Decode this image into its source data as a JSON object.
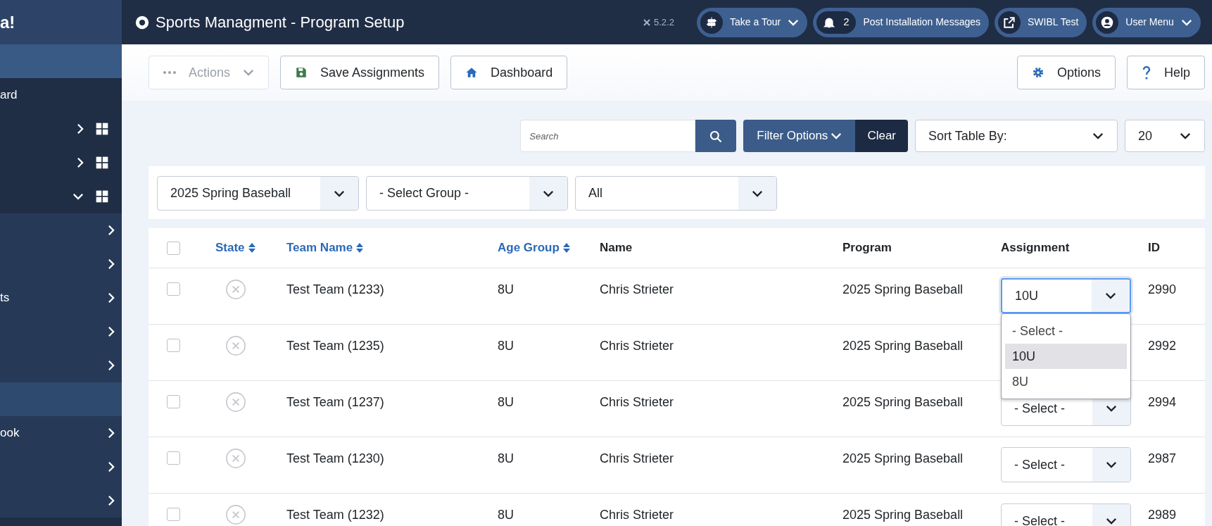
{
  "sidebar": {
    "logo_text": "a!",
    "items": [
      {
        "kind": "link",
        "selected": true
      },
      {
        "kind": "link",
        "label": "ard",
        "selected": false
      },
      {
        "kind": "menu",
        "expanded": false
      },
      {
        "kind": "menu",
        "expanded": false
      },
      {
        "kind": "menu",
        "expanded": true,
        "children": [
          {
            "kind": "submenu",
            "selected": false
          },
          {
            "kind": "submenu",
            "selected": false
          },
          {
            "kind": "submenu",
            "label": "ts",
            "selected": false
          },
          {
            "kind": "submenu",
            "selected": false
          },
          {
            "kind": "submenu",
            "selected": false
          },
          {
            "kind": "link",
            "selected": true
          },
          {
            "kind": "submenu",
            "label": "ook",
            "selected": false
          },
          {
            "kind": "submenu",
            "selected": false
          },
          {
            "kind": "submenu",
            "selected": false
          }
        ]
      }
    ]
  },
  "header": {
    "title": "Sports Managment - Program Setup",
    "version": "5.2.2",
    "buttons": [
      {
        "kind": "tour",
        "label": "Take a Tour"
      },
      {
        "kind": "messages",
        "count": "2",
        "label": "Post Installation Messages"
      },
      {
        "kind": "site",
        "label": "SWIBL Test"
      },
      {
        "kind": "user",
        "label": "User Menu"
      }
    ]
  },
  "toolbar": {
    "left": [
      {
        "kind": "actions",
        "label": "Actions",
        "disabled": true
      },
      {
        "kind": "save",
        "label": "Save Assignments",
        "disabled": false
      },
      {
        "kind": "home",
        "label": "Dashboard",
        "disabled": false
      }
    ],
    "right": [
      {
        "kind": "options",
        "label": "Options"
      },
      {
        "kind": "help",
        "label": "Help"
      }
    ]
  },
  "search": {
    "placeholder": "Search",
    "filter_button": "Filter Options",
    "clear_button": "Clear",
    "sort": "Sort Table By:",
    "limit": "20"
  },
  "filters": [
    "2025 Spring Baseball",
    "- Select Group -",
    "All"
  ],
  "table": {
    "select_all_checked": false,
    "columns": [
      {
        "label": "State",
        "sortable": true
      },
      {
        "label": "Team Name",
        "sortable": true
      },
      {
        "label": "Age Group",
        "sortable": true
      },
      {
        "label": "Name",
        "sortable": false
      },
      {
        "label": "Program",
        "sortable": false
      },
      {
        "label": "Assignment",
        "sortable": false
      },
      {
        "label": "ID",
        "sortable": false
      }
    ],
    "assignment_options": [
      {
        "label": "- Select -",
        "selected": false
      },
      {
        "label": "10U",
        "selected": true
      },
      {
        "label": "8U",
        "selected": false
      }
    ],
    "rows": [
      {
        "checked": false,
        "published": false,
        "team": "Test Team (1233)",
        "age": "8U",
        "name": "Chris Strieter",
        "program": "2025 Spring Baseball",
        "assignment": "10U",
        "dropdown_open": true,
        "id": "2990"
      },
      {
        "checked": false,
        "published": false,
        "team": "Test Team (1235)",
        "age": "8U",
        "name": "Chris Strieter",
        "program": "2025 Spring Baseball",
        "id": "2992"
      },
      {
        "checked": false,
        "published": false,
        "team": "Test Team (1237)",
        "age": "8U",
        "name": "Chris Strieter",
        "program": "2025 Spring Baseball",
        "assignment": "- Select -",
        "dropdown_open": false,
        "id": "2994"
      },
      {
        "checked": false,
        "published": false,
        "team": "Test Team (1230)",
        "age": "8U",
        "name": "Chris Strieter",
        "program": "2025 Spring Baseball",
        "assignment": "- Select -",
        "dropdown_open": false,
        "id": "2987"
      },
      {
        "checked": false,
        "published": false,
        "team": "Test Team (1232)",
        "age": "8U",
        "name": "Chris Strieter",
        "program": "2025 Spring Baseball",
        "assignment": "- Select -",
        "dropdown_open": false,
        "id": "2989"
      }
    ]
  }
}
